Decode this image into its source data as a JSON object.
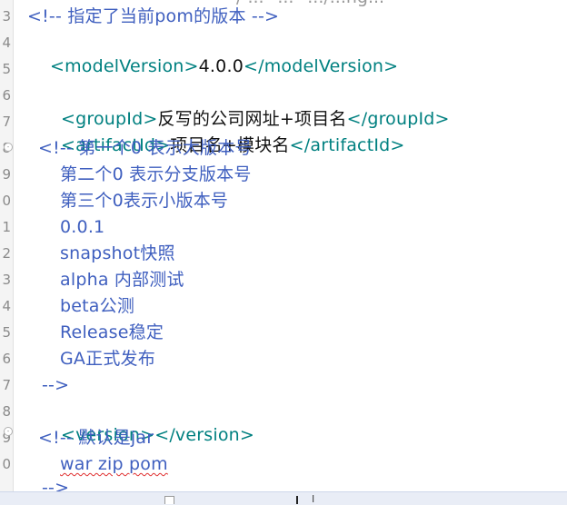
{
  "editor": {
    "clipped_top_text": "/ ... \"...\" .../...ng...",
    "line_numbers": [
      "3",
      "4",
      "5",
      "6",
      "7",
      "8",
      "9",
      "0",
      "1",
      "2",
      "3",
      "4",
      "5",
      "6",
      "7",
      "8",
      "9",
      "0",
      ""
    ],
    "lines": {
      "comment_pom_version": "<!-- 指定了当前pom的版本 -->",
      "model_version_open": "<modelVersion>",
      "model_version_value": "4.0.0",
      "model_version_close": "</modelVersion>",
      "group_open": "<groupId>",
      "group_value": "反写的公司网址+项目名",
      "group_close": "</groupId>",
      "artifact_open": "<artifactId>",
      "artifact_value": "项目名+模块名",
      "artifact_close": "</artifactId>",
      "ver_comment_1": "<!-- 第一个0 表示大版本号",
      "ver_comment_2": "第二个0 表示分支版本号",
      "ver_comment_3": "第三个0表示小版本号",
      "ver_comment_4": "0.0.1",
      "ver_comment_5": "snapshot快照",
      "ver_comment_6": "alpha 内部测试",
      "ver_comment_7": "beta公测",
      "ver_comment_8": "Release稳定",
      "ver_comment_9": "GA正式发布",
      "ver_comment_end": "-->",
      "version_open": "<version>",
      "version_close": "</version>",
      "pack_comment_1": "<!-- 默认是jar",
      "pack_comment_2": "war zip pom",
      "pack_comment_end": "-->"
    }
  },
  "colors": {
    "comment": "#3f5fbf",
    "bracket": "#008080",
    "text": "#111111",
    "spell_underline": "#e03030"
  }
}
